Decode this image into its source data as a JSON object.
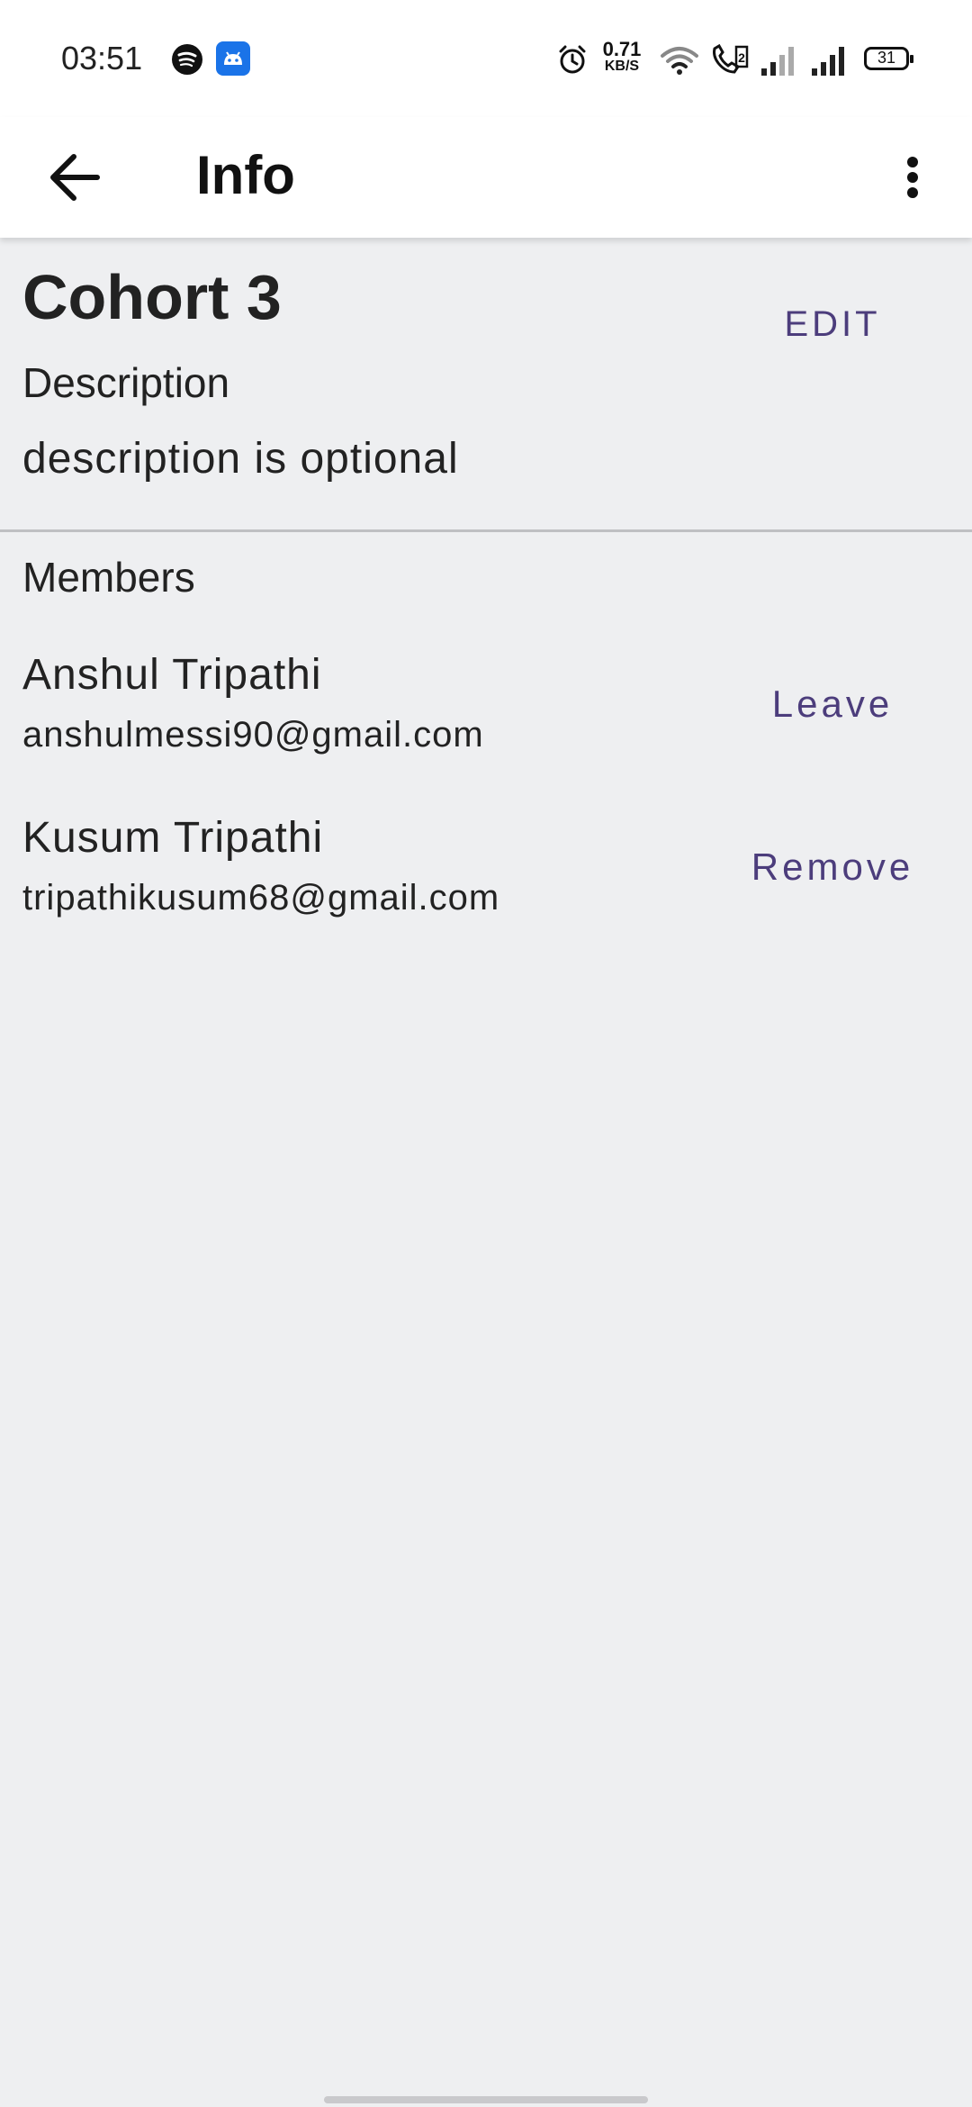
{
  "status_bar": {
    "time": "03:51",
    "net_speed_value": "0.71",
    "net_speed_unit": "KB/S",
    "battery": "31",
    "icons": [
      "spotify-icon",
      "android-app-icon",
      "alarm-icon",
      "wifi-icon",
      "volte-call-icon",
      "signal-icon",
      "signal-icon",
      "battery-icon"
    ]
  },
  "app_bar": {
    "title": "Info",
    "back_icon": "arrow-left-icon",
    "menu_icon": "more-vert-icon"
  },
  "group": {
    "name": "Cohort 3",
    "edit_label": "EDIT",
    "description_label": "Description",
    "description_text": "description is optional"
  },
  "members": {
    "label": "Members",
    "items": [
      {
        "name": "Anshul Tripathi",
        "email": "anshulmessi90@gmail.com",
        "action": "Leave"
      },
      {
        "name": "Kusum Tripathi",
        "email": "tripathikusum68@gmail.com",
        "action": "Remove"
      }
    ]
  },
  "colors": {
    "accent": "#4c3d7c",
    "background": "#eeeff1",
    "surface": "#ffffff"
  }
}
